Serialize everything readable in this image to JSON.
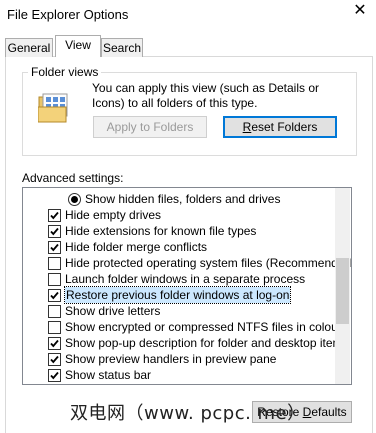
{
  "window": {
    "title": "File Explorer Options",
    "close_icon": "close-icon"
  },
  "tabs": [
    {
      "label": "General",
      "active": false
    },
    {
      "label": "View",
      "active": true
    },
    {
      "label": "Search",
      "active": false
    }
  ],
  "folder_views": {
    "legend": "Folder views",
    "description": "You can apply this view (such as Details or Icons) to all folders of this type.",
    "apply_button": "Apply to Folders",
    "reset_button_prefix": "",
    "reset_button_accel": "R",
    "reset_button_rest": "eset Folders"
  },
  "advanced": {
    "label": "Advanced settings:",
    "items": [
      {
        "type": "radio",
        "checked": true,
        "label": "Show hidden files, folders and drives"
      },
      {
        "type": "checkbox",
        "checked": true,
        "label": "Hide empty drives"
      },
      {
        "type": "checkbox",
        "checked": true,
        "label": "Hide extensions for known file types"
      },
      {
        "type": "checkbox",
        "checked": true,
        "label": "Hide folder merge conflicts"
      },
      {
        "type": "checkbox",
        "checked": false,
        "label": "Hide protected operating system files (Recommended)"
      },
      {
        "type": "checkbox",
        "checked": false,
        "label": "Launch folder windows in a separate process"
      },
      {
        "type": "checkbox",
        "checked": true,
        "label": "Restore previous folder windows at log-on",
        "selected": true
      },
      {
        "type": "checkbox",
        "checked": false,
        "label": "Show drive letters"
      },
      {
        "type": "checkbox",
        "checked": false,
        "label": "Show encrypted or compressed NTFS files in colour"
      },
      {
        "type": "checkbox",
        "checked": true,
        "label": "Show pop-up description for folder and desktop items"
      },
      {
        "type": "checkbox",
        "checked": true,
        "label": "Show preview handlers in preview pane"
      },
      {
        "type": "checkbox",
        "checked": true,
        "label": "Show status bar"
      }
    ]
  },
  "restore_defaults": {
    "prefix": "Restore ",
    "accel": "D",
    "rest": "efaults"
  },
  "watermark": "双电网（www. pcpc. me）"
}
